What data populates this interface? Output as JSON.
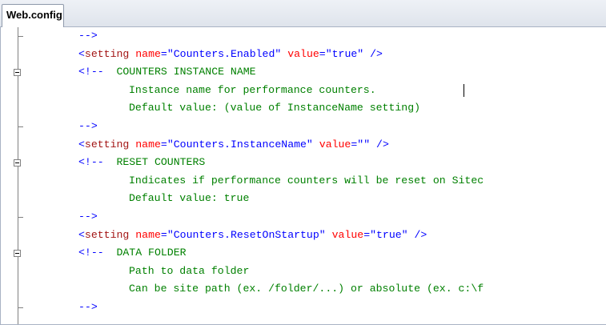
{
  "tab": {
    "label": "Web.config"
  },
  "lines": [
    {
      "kind": "comment-end",
      "text": "-->"
    },
    {
      "kind": "setting",
      "open": "<setting",
      "a1": "name",
      "v1": "\"Counters.Enabled\"",
      "a2": "value",
      "v2": "\"true\"",
      "close": "/>"
    },
    {
      "kind": "comment-start",
      "text": "<!--  COUNTERS INSTANCE NAME"
    },
    {
      "kind": "comment-body",
      "text": "Instance name for performance counters."
    },
    {
      "kind": "comment-body",
      "text": "Default value: (value of InstanceName setting)"
    },
    {
      "kind": "comment-end",
      "text": "-->"
    },
    {
      "kind": "setting",
      "open": "<setting",
      "a1": "name",
      "v1": "\"Counters.InstanceName\"",
      "a2": "value",
      "v2": "\"\"",
      "close": "/>"
    },
    {
      "kind": "comment-start",
      "text": "<!--  RESET COUNTERS"
    },
    {
      "kind": "comment-body",
      "text": "Indicates if performance counters will be reset on Sitec"
    },
    {
      "kind": "comment-body",
      "text": "Default value: true"
    },
    {
      "kind": "comment-end",
      "text": "-->"
    },
    {
      "kind": "setting",
      "open": "<setting",
      "a1": "name",
      "v1": "\"Counters.ResetOnStartup\"",
      "a2": "value",
      "v2": "\"true\"",
      "close": "/>"
    },
    {
      "kind": "comment-start",
      "text": "<!--  DATA FOLDER"
    },
    {
      "kind": "comment-body",
      "text": "Path to data folder"
    },
    {
      "kind": "comment-body",
      "text": "Can be site path (ex. /folder/...) or absolute (ex. c:\\f"
    },
    {
      "kind": "comment-end",
      "text": "-->"
    }
  ],
  "colors": {
    "tag": "#0000ff",
    "element": "#a31515",
    "attribute": "#ff0000",
    "attribute_value": "#0000ff",
    "comment": "#008000"
  }
}
